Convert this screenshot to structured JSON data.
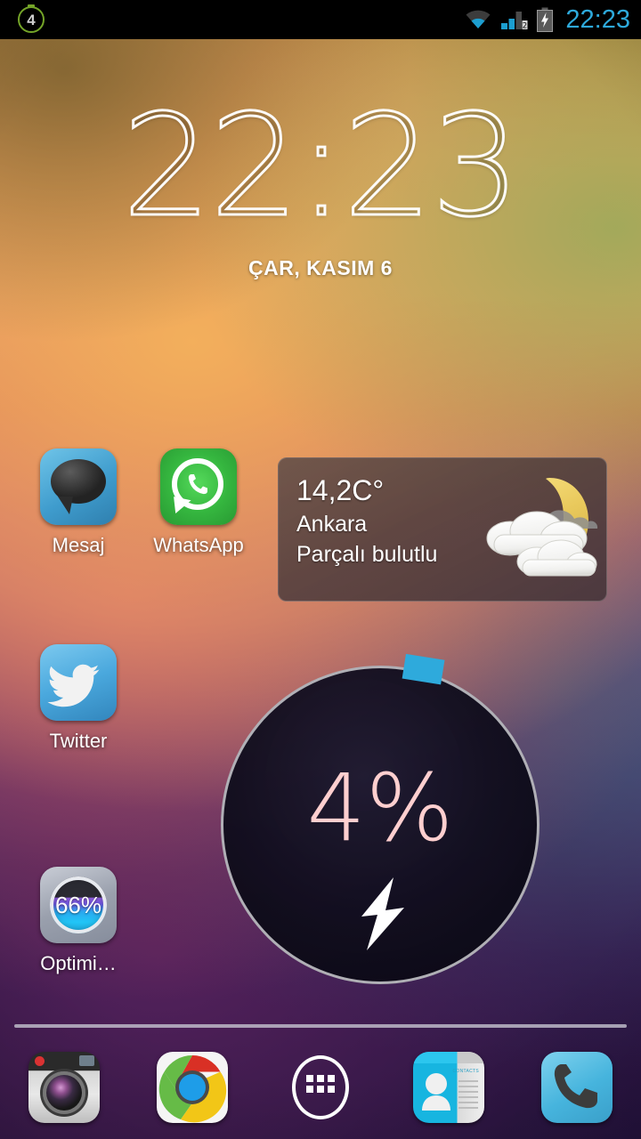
{
  "status_bar": {
    "notification_badge": "4",
    "clock": "22:23",
    "icons": [
      "wifi-icon",
      "signal-icon",
      "battery-charging-icon"
    ],
    "accent_color": "#2eaadc"
  },
  "clock_widget": {
    "time": "22:23",
    "date": "ÇAR, KASIM 6"
  },
  "apps": [
    {
      "label": "Mesaj",
      "icon": "messaging-icon"
    },
    {
      "label": "WhatsApp",
      "icon": "whatsapp-icon"
    },
    {
      "label": "Twitter",
      "icon": "twitter-icon"
    },
    {
      "label": "Optimi…",
      "icon": "optimizer-icon",
      "badge": "66%"
    }
  ],
  "weather_widget": {
    "temperature": "14,2C°",
    "city": "Ankara",
    "condition": "Parçalı bulutlu",
    "icon": "moon-behind-cloud-icon"
  },
  "battery_widget": {
    "percent": "4%",
    "charging_icon": "lightning-bolt-icon",
    "marker_color": "#2eaadc",
    "ring_color": "#bebec3",
    "text_color": "#ffcfcf"
  },
  "dock": [
    {
      "label": "camera",
      "icon": "camera-icon"
    },
    {
      "label": "chrome",
      "icon": "chrome-icon"
    },
    {
      "label": "app-drawer",
      "icon": "app-drawer-icon"
    },
    {
      "label": "contacts",
      "icon": "contacts-icon"
    },
    {
      "label": "phone",
      "icon": "phone-icon"
    }
  ]
}
